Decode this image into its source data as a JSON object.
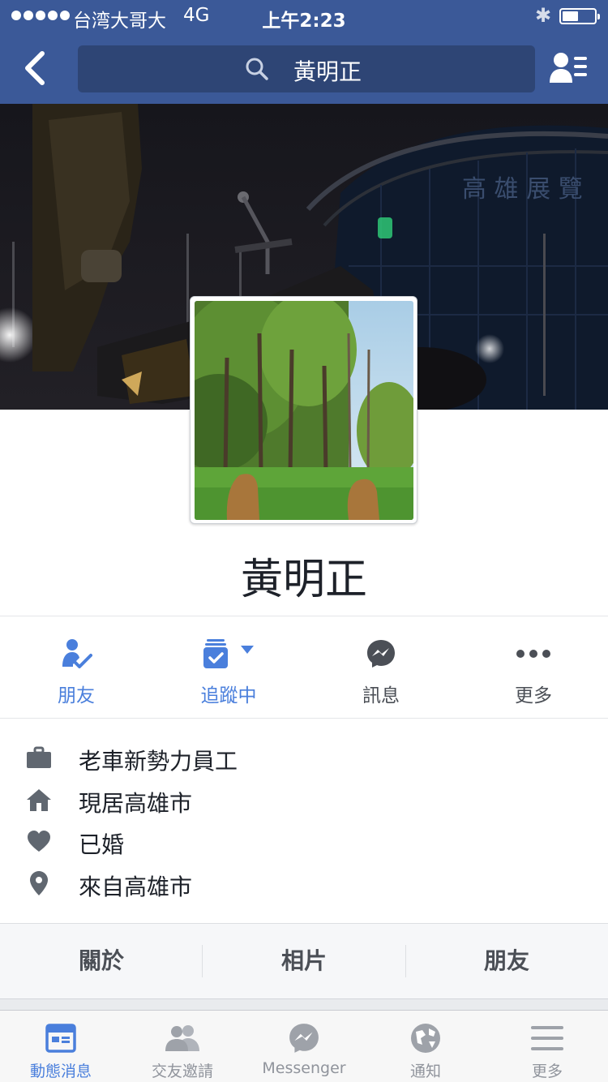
{
  "status_bar": {
    "carrier": "台湾大哥大",
    "network": "4G",
    "time": "上午2:23",
    "battery_level": 0.5
  },
  "nav": {
    "back_icon": "chevron-left-icon",
    "search_text": "黃明正",
    "search_icon": "search-icon",
    "profile_menu_icon": "friend-list-icon"
  },
  "profile": {
    "name": "黃明正"
  },
  "actions": [
    {
      "label": "朋友",
      "icon": "friends-check-icon",
      "color": "#4a7fdc"
    },
    {
      "label": "追蹤中",
      "icon": "following-icon",
      "color": "#4a7fdc"
    },
    {
      "label": "訊息",
      "icon": "messenger-icon",
      "color": "#4b4f56"
    },
    {
      "label": "更多",
      "icon": "more-dots-icon",
      "color": "#4b4f56"
    }
  ],
  "info": [
    {
      "icon": "briefcase-icon",
      "text": "老車新勢力員工"
    },
    {
      "icon": "home-icon",
      "text": "現居高雄市"
    },
    {
      "icon": "heart-icon",
      "text": "已婚"
    },
    {
      "icon": "location-pin-icon",
      "text": "來自高雄市"
    }
  ],
  "tabs": [
    "關於",
    "相片",
    "朋友"
  ],
  "bottom_tabs": [
    {
      "label": "動態消息",
      "icon": "news-feed-icon",
      "active": true
    },
    {
      "label": "交友邀請",
      "icon": "friend-requests-icon",
      "active": false
    },
    {
      "label": "Messenger",
      "icon": "messenger-icon",
      "active": false
    },
    {
      "label": "通知",
      "icon": "globe-icon",
      "active": false
    },
    {
      "label": "更多",
      "icon": "menu-icon",
      "active": false
    }
  ],
  "colors": {
    "brand": "#3b5998",
    "accent": "#4a7fdc",
    "text": "#1d2129",
    "muted": "#90949c"
  }
}
